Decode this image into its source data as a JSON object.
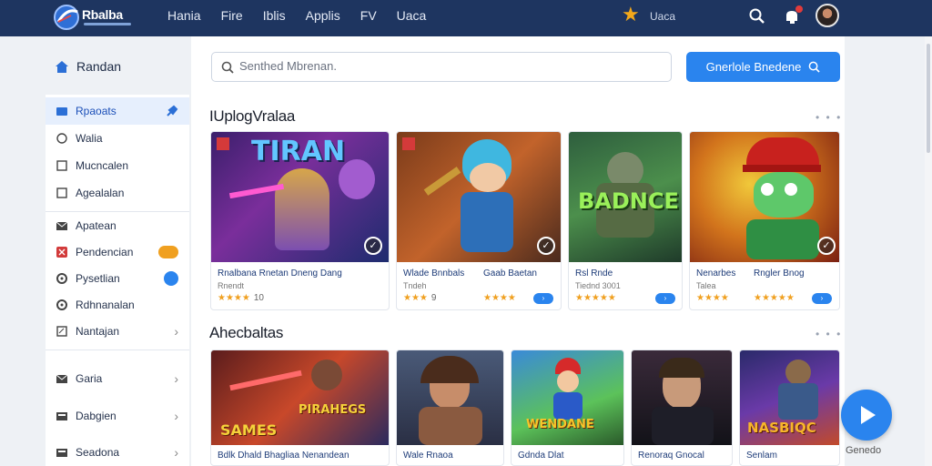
{
  "header": {
    "brand": "Rbalba",
    "nav": [
      "Hania",
      "Fire",
      "Iblis",
      "Applis",
      "FV",
      "Uaca"
    ],
    "points": "Uaca",
    "colors": {
      "bar": "#1e3560",
      "accent": "#2a84ee",
      "star": "#f3a81a"
    }
  },
  "sidebar": {
    "title": "Randan",
    "items": [
      {
        "label": "Rpaoats",
        "icon": "folder-icon",
        "active": true,
        "right": "pin-icon"
      },
      {
        "label": "Walia",
        "icon": "circle-icon"
      },
      {
        "label": "Mucncalen",
        "icon": "square-icon"
      },
      {
        "label": "Agealalan",
        "icon": "square-icon"
      },
      {
        "label": "Apatean",
        "icon": "mail-icon"
      },
      {
        "label": "Pendencian",
        "icon": "flag-icon",
        "right": "toggle-orange"
      },
      {
        "label": "Pysetlian",
        "icon": "gear-icon",
        "right": "toggle-blue"
      },
      {
        "label": "Rdhnanalan",
        "icon": "gear-icon"
      },
      {
        "label": "Nantajan",
        "icon": "note-icon",
        "right": "chevron"
      },
      {
        "label": "Garia",
        "icon": "mail-icon",
        "right": "chevron"
      },
      {
        "label": "Dabgien",
        "icon": "box-icon",
        "right": "chevron"
      },
      {
        "label": "Seadona",
        "icon": "box-icon",
        "right": "chevron"
      }
    ]
  },
  "search": {
    "placeholder": "Senthed Mbrenan.",
    "button_label": "Gnerlole Bnedene"
  },
  "sections": [
    {
      "title": "IUplogVralaa",
      "cards": [
        {
          "art_text": "TIRAN",
          "name": "Rnalbana Rnetan Dneng Dang",
          "sub": "Rnendt",
          "rating": "★★★★",
          "count": "10"
        },
        {
          "art_text": "",
          "name": "Wlade Bnnbals",
          "sub": "Tndeh",
          "rating": "★★★",
          "count": "9",
          "name2": "Gaab Baetan",
          "rating2": "★★★★"
        },
        {
          "art_text": "BADNCE",
          "name": "Rsl Rnde",
          "sub": "Tiednd 3001",
          "rating": "★★★★★"
        },
        {
          "art_text": "",
          "name": "Nenarbes",
          "sub": "Talea",
          "rating": "★★★★",
          "name2": "Rngler Bnog",
          "rating2": "★★★★★"
        }
      ]
    },
    {
      "title": "Ahecbaltas",
      "cards": [
        {
          "art_text": "SAMES",
          "art_text2": "PIRAHEGS",
          "name": "Bdlk Dhald Bhagliaa Nenandean"
        },
        {
          "art_text": "",
          "name": "Wale Rnaoa"
        },
        {
          "art_text": "WENDANE",
          "name": "Gdnda Dlat"
        },
        {
          "art_text": "",
          "name": "Renoraq Gnocal"
        },
        {
          "art_text": "NASBIQC",
          "name": "Senlam"
        }
      ]
    }
  ],
  "fab": {
    "label": "Genedo",
    "icon": "play-icon"
  }
}
